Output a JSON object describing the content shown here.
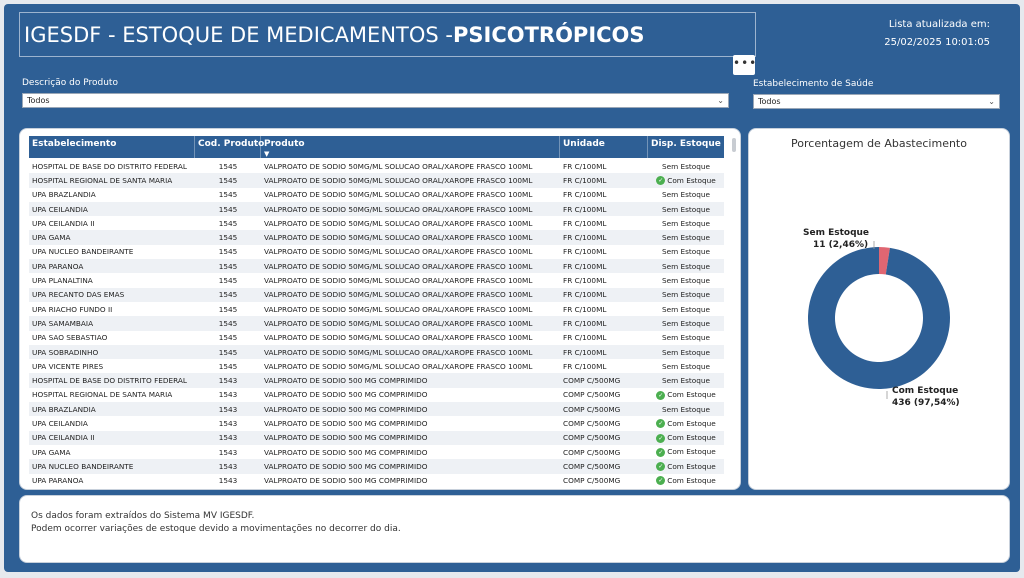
{
  "header": {
    "title_prefix": "IGESDF - ESTOQUE DE  MEDICAMENTOS - ",
    "title_bold": "PSICOTRÓPICOS",
    "updated_label": "Lista atualizada em:",
    "updated_value": "25/02/2025 10:01:05",
    "more_label": "•••"
  },
  "filters": {
    "produto_label": "Descrição do Produto",
    "produto_value": "Todos",
    "estab_label": "Estabelecimento de Saúde",
    "estab_value": "Todos"
  },
  "table": {
    "columns": [
      "Estabelecimento",
      "Cod. Produto",
      "Produto",
      "Unidade",
      "Disp. Estoque"
    ],
    "rows": [
      [
        "HOSPITAL DE BASE DO DISTRITO FEDERAL",
        "1545",
        "VALPROATO DE SODIO 50MG/ML SOLUCAO ORAL/XAROPE FRASCO 100ML",
        "FR C/100ML",
        "Sem Estoque"
      ],
      [
        "HOSPITAL REGIONAL DE SANTA MARIA",
        "1545",
        "VALPROATO DE SODIO 50MG/ML SOLUCAO ORAL/XAROPE FRASCO 100ML",
        "FR C/100ML",
        "Com Estoque"
      ],
      [
        "UPA BRAZLANDIA",
        "1545",
        "VALPROATO DE SODIO 50MG/ML SOLUCAO ORAL/XAROPE FRASCO 100ML",
        "FR C/100ML",
        "Sem Estoque"
      ],
      [
        "UPA CEILANDIA",
        "1545",
        "VALPROATO DE SODIO 50MG/ML SOLUCAO ORAL/XAROPE FRASCO 100ML",
        "FR C/100ML",
        "Sem Estoque"
      ],
      [
        "UPA CEILANDIA II",
        "1545",
        "VALPROATO DE SODIO 50MG/ML SOLUCAO ORAL/XAROPE FRASCO 100ML",
        "FR C/100ML",
        "Sem Estoque"
      ],
      [
        "UPA GAMA",
        "1545",
        "VALPROATO DE SODIO 50MG/ML SOLUCAO ORAL/XAROPE FRASCO 100ML",
        "FR C/100ML",
        "Sem Estoque"
      ],
      [
        "UPA NUCLEO BANDEIRANTE",
        "1545",
        "VALPROATO DE SODIO 50MG/ML SOLUCAO ORAL/XAROPE FRASCO 100ML",
        "FR C/100ML",
        "Sem Estoque"
      ],
      [
        "UPA PARANOA",
        "1545",
        "VALPROATO DE SODIO 50MG/ML SOLUCAO ORAL/XAROPE FRASCO 100ML",
        "FR C/100ML",
        "Sem Estoque"
      ],
      [
        "UPA PLANALTINA",
        "1545",
        "VALPROATO DE SODIO 50MG/ML SOLUCAO ORAL/XAROPE FRASCO 100ML",
        "FR C/100ML",
        "Sem Estoque"
      ],
      [
        "UPA RECANTO DAS EMAS",
        "1545",
        "VALPROATO DE SODIO 50MG/ML SOLUCAO ORAL/XAROPE FRASCO 100ML",
        "FR C/100ML",
        "Sem Estoque"
      ],
      [
        "UPA RIACHO FUNDO II",
        "1545",
        "VALPROATO DE SODIO 50MG/ML SOLUCAO ORAL/XAROPE FRASCO 100ML",
        "FR C/100ML",
        "Sem Estoque"
      ],
      [
        "UPA SAMAMBAIA",
        "1545",
        "VALPROATO DE SODIO 50MG/ML SOLUCAO ORAL/XAROPE FRASCO 100ML",
        "FR C/100ML",
        "Sem Estoque"
      ],
      [
        "UPA SAO SEBASTIAO",
        "1545",
        "VALPROATO DE SODIO 50MG/ML SOLUCAO ORAL/XAROPE FRASCO 100ML",
        "FR C/100ML",
        "Sem Estoque"
      ],
      [
        "UPA SOBRADINHO",
        "1545",
        "VALPROATO DE SODIO 50MG/ML SOLUCAO ORAL/XAROPE FRASCO 100ML",
        "FR C/100ML",
        "Sem Estoque"
      ],
      [
        "UPA VICENTE PIRES",
        "1545",
        "VALPROATO DE SODIO 50MG/ML SOLUCAO ORAL/XAROPE FRASCO 100ML",
        "FR C/100ML",
        "Sem Estoque"
      ],
      [
        "HOSPITAL DE BASE DO DISTRITO FEDERAL",
        "1543",
        "VALPROATO DE SODIO 500 MG COMPRIMIDO",
        "COMP C/500MG",
        "Sem Estoque"
      ],
      [
        "HOSPITAL REGIONAL DE SANTA MARIA",
        "1543",
        "VALPROATO DE SODIO 500 MG COMPRIMIDO",
        "COMP C/500MG",
        "Com Estoque"
      ],
      [
        "UPA BRAZLANDIA",
        "1543",
        "VALPROATO DE SODIO 500 MG COMPRIMIDO",
        "COMP C/500MG",
        "Sem Estoque"
      ],
      [
        "UPA CEILANDIA",
        "1543",
        "VALPROATO DE SODIO 500 MG COMPRIMIDO",
        "COMP C/500MG",
        "Com Estoque"
      ],
      [
        "UPA CEILANDIA II",
        "1543",
        "VALPROATO DE SODIO 500 MG COMPRIMIDO",
        "COMP C/500MG",
        "Com Estoque"
      ],
      [
        "UPA GAMA",
        "1543",
        "VALPROATO DE SODIO 500 MG COMPRIMIDO",
        "COMP C/500MG",
        "Com Estoque"
      ],
      [
        "UPA NUCLEO BANDEIRANTE",
        "1543",
        "VALPROATO DE SODIO 500 MG COMPRIMIDO",
        "COMP C/500MG",
        "Com Estoque"
      ],
      [
        "UPA PARANOA",
        "1543",
        "VALPROATO DE SODIO 500 MG COMPRIMIDO",
        "COMP C/500MG",
        "Com Estoque"
      ]
    ]
  },
  "chart_data": {
    "type": "pie",
    "title": "Porcentagem de Abastecimento",
    "categories": [
      "Sem Estoque",
      "Com Estoque"
    ],
    "values": [
      11,
      436
    ],
    "labels": [
      "11 (2,46%)",
      "436 (97,54%)"
    ],
    "colors": [
      "#e06672",
      "#2e5f95"
    ]
  },
  "note": {
    "line1": "Os dados foram extraídos do Sistema MV IGESDF.",
    "line2": "Podem ocorrer variações de estoque devido a movimentações no decorrer do dia."
  }
}
